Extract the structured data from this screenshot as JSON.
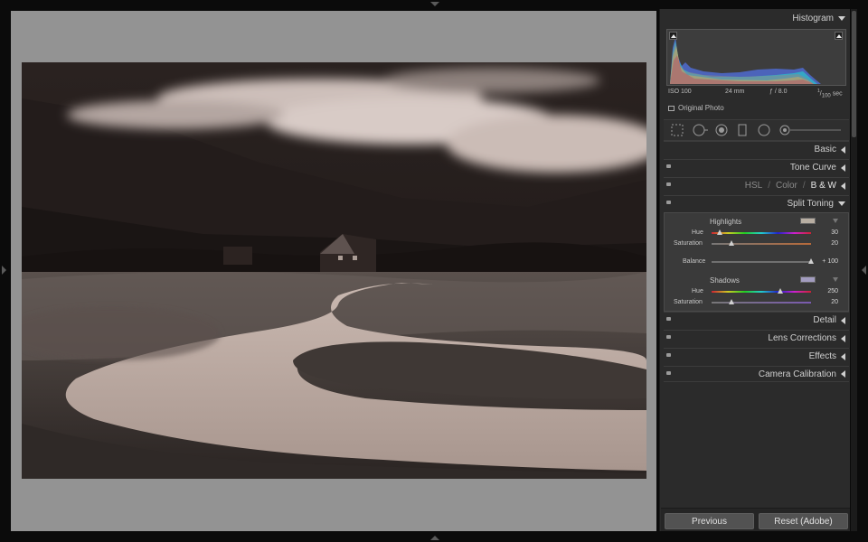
{
  "panel": {
    "histogram_title": "Histogram",
    "exif": {
      "iso": "ISO 100",
      "focal": "24 mm",
      "aperture": "ƒ / 8.0",
      "shutter_num": "1",
      "shutter_den": "100",
      "shutter_unit": "sec"
    },
    "original_photo": "Original Photo",
    "sections": {
      "basic": "Basic",
      "tone_curve": "Tone Curve",
      "hsl": "HSL",
      "sep1": "/",
      "color": "Color",
      "sep2": "/",
      "bw": "B & W",
      "split_toning": "Split Toning",
      "detail": "Detail",
      "lens_corrections": "Lens Corrections",
      "effects": "Effects",
      "camera_calibration": "Camera Calibration"
    },
    "split_toning": {
      "highlights_label": "Highlights",
      "highlights_swatch": "#b8aea2",
      "highlights_hue_label": "Hue",
      "highlights_hue": 30,
      "highlights_sat_label": "Saturation",
      "highlights_sat": 20,
      "balance_label": "Balance",
      "balance_display": "+ 100",
      "balance": 100,
      "shadows_label": "Shadows",
      "shadows_swatch": "#a29cbf",
      "shadows_hue_label": "Hue",
      "shadows_hue": 250,
      "shadows_sat_label": "Saturation",
      "shadows_sat": 20
    }
  },
  "buttons": {
    "previous": "Previous",
    "reset": "Reset (Adobe)"
  },
  "icons": {
    "crop": "crop-overlay-icon",
    "spot": "spot-removal-icon",
    "redeye": "red-eye-icon",
    "graduated": "graduated-filter-icon",
    "radial": "radial-filter-icon",
    "brush": "adjustment-brush-icon"
  },
  "colors": {
    "panel_bg": "#2b2b2b",
    "canvas_bg": "#939393",
    "text": "#cfcfcf"
  }
}
